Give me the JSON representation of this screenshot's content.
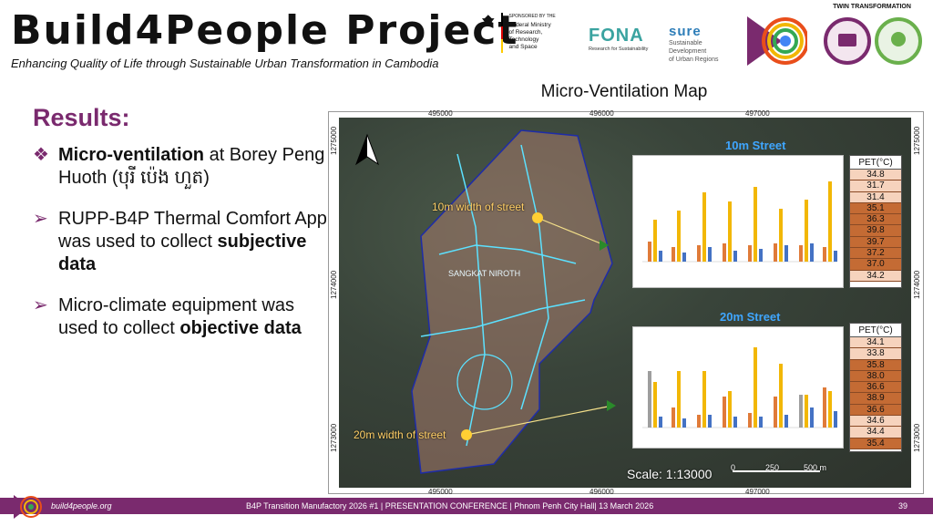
{
  "header": {
    "title": "Build4People Project",
    "subtitle": "Enhancing Quality of Life through Sustainable Urban Transformation in Cambodia"
  },
  "sponsors": {
    "bmbf_label": "SPONSORED BY THE",
    "bmbf_line1": "Federal Ministry",
    "bmbf_line2": "of Research, Technology",
    "bmbf_line3": "and Space",
    "fona_word": "FONA",
    "fona_sub": "Research for Sustainability",
    "sure_word": "sure",
    "sure_line1": "Sustainable",
    "sure_line2": "Development",
    "sure_line3": "of Urban Regions",
    "twin_title": "TWIN TRANSFORMATION"
  },
  "results": {
    "heading": "Results:",
    "bullet1_bold": "Micro-ventilation",
    "bullet1_rest": " at Borey Peng Huoth (បុរី ប៉េង ហួត)",
    "bullet2_rest": "RUPP-B4P Thermal Comfort App was used to collect ",
    "bullet2_bold": "subjective data",
    "bullet3_rest": "Micro-climate equipment was used to collect ",
    "bullet3_bold": "objective data",
    "mark1": "❖",
    "mark2": "➢",
    "mark3": "➢"
  },
  "map": {
    "title": "Micro-Ventilation Map",
    "coords_top": [
      "495000",
      "496000",
      "497000"
    ],
    "coords_bottom": [
      "495000",
      "496000",
      "497000"
    ],
    "coords_left": [
      "1275000",
      "1274000",
      "1273000"
    ],
    "coords_right": [
      "1275000",
      "1274000",
      "1273000"
    ],
    "street10_label": "10m width of street",
    "street20_label": "20m width of street",
    "street_name": "SANGKAT NIROTH",
    "panel10_label": "10m Street",
    "panel20_label": "20m Street",
    "pet_header": "PET(°C)",
    "pet10": [
      "34.8",
      "31.7",
      "31.4",
      "35.1",
      "36.3",
      "39.8",
      "39.7",
      "37.2",
      "37.0",
      "34.2"
    ],
    "pet20": [
      "34.1",
      "33.8",
      "35.8",
      "38.0",
      "36.6",
      "38.9",
      "36.6",
      "34.6",
      "34.4",
      "35.4"
    ],
    "scale": "Scale: 1:13000",
    "scale_ticks": [
      "0",
      "250",
      "500 m"
    ]
  },
  "colors": {
    "brand_purple": "#7a2a6e",
    "pet_light": "#f6d3bd",
    "pet_dark": "#c46b34",
    "street_blue": "#3fa6ff"
  },
  "footer": {
    "site": "build4people.org",
    "conference": "B4P Transition Manufactory 2026 #1 | PRESENTATION CONFERENCE | Phnom Penh City Hall| 13 March 2026",
    "page": "39"
  }
}
